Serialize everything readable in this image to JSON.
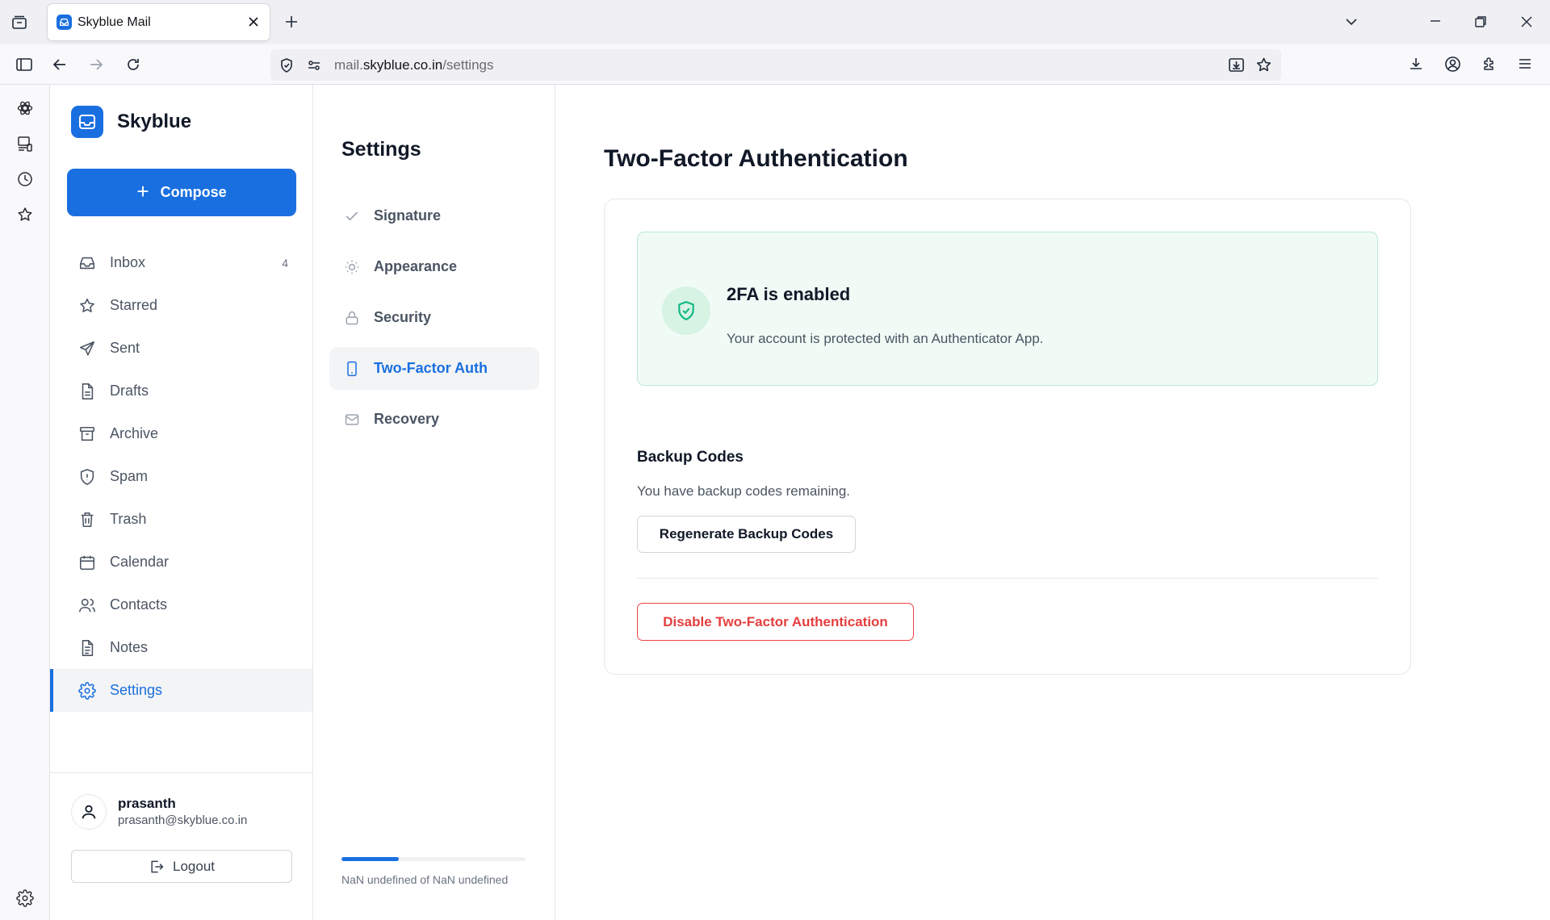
{
  "browser": {
    "tab_title": "Skyblue Mail",
    "url_domain_prefix": "mail.",
    "url_domain": "skyblue.co.in",
    "url_path": "/settings"
  },
  "app": {
    "brand": "Skyblue",
    "compose_label": "Compose",
    "accent_color": "#1a6fe0",
    "nav": [
      {
        "label": "Inbox",
        "count": "4",
        "icon": "inbox-icon"
      },
      {
        "label": "Starred",
        "icon": "star-icon"
      },
      {
        "label": "Sent",
        "icon": "send-icon"
      },
      {
        "label": "Drafts",
        "icon": "draft-icon"
      },
      {
        "label": "Archive",
        "icon": "archive-icon"
      },
      {
        "label": "Spam",
        "icon": "spam-icon"
      },
      {
        "label": "Trash",
        "icon": "trash-icon"
      },
      {
        "label": "Calendar",
        "icon": "calendar-icon"
      },
      {
        "label": "Contacts",
        "icon": "contacts-icon"
      },
      {
        "label": "Notes",
        "icon": "notes-icon"
      },
      {
        "label": "Settings",
        "icon": "gear-icon",
        "active": true
      }
    ],
    "user": {
      "name": "prasanth",
      "email": "prasanth@skyblue.co.in",
      "logout_label": "Logout"
    }
  },
  "settings_nav": {
    "title": "Settings",
    "items": [
      {
        "label": "Signature",
        "icon": "check-icon"
      },
      {
        "label": "Appearance",
        "icon": "sun-icon"
      },
      {
        "label": "Security",
        "icon": "lock-icon"
      },
      {
        "label": "Two-Factor Auth",
        "icon": "phone-icon",
        "active": true
      },
      {
        "label": "Recovery",
        "icon": "mail-icon"
      }
    ],
    "storage_progress": 0.31,
    "storage_text": "NaN undefined of NaN undefined"
  },
  "main": {
    "title": "Two-Factor Authentication",
    "status": {
      "title": "2FA is enabled",
      "description": "Your account is protected with an Authenticator App.",
      "color": "#10b981"
    },
    "backup": {
      "title": "Backup Codes",
      "description": "You have backup codes remaining.",
      "regenerate_label": "Regenerate Backup Codes"
    },
    "disable_label": "Disable Two-Factor Authentication",
    "danger_color": "#e53e3e"
  }
}
